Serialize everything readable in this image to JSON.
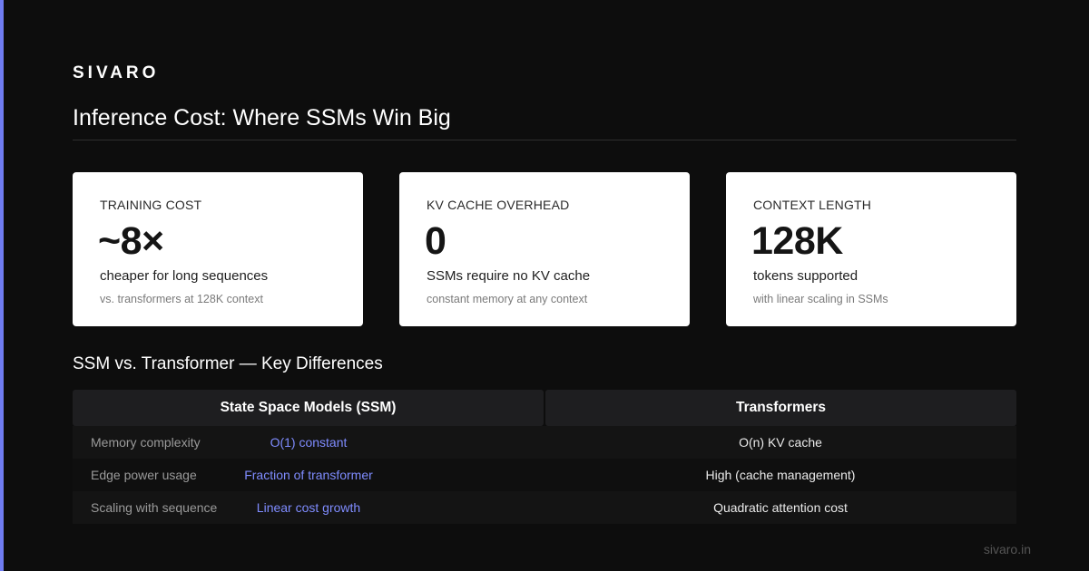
{
  "brand": "SIVARO",
  "title": "Inference Cost: Where SSMs Win Big",
  "cards": [
    {
      "label": "TRAINING COST",
      "value": "~8×",
      "desc": "cheaper for long sequences",
      "note": "vs. transformers at 128K context"
    },
    {
      "label": "KV CACHE OVERHEAD",
      "value": "0",
      "desc": "SSMs require no KV cache",
      "note": "constant memory at any context"
    },
    {
      "label": "CONTEXT LENGTH",
      "value": "128K",
      "desc": "tokens supported",
      "note": "with linear scaling in SSMs"
    }
  ],
  "comparison": {
    "title": "SSM vs. Transformer — Key Differences",
    "headers": {
      "ssm": "State Space Models (SSM)",
      "transformer": "Transformers"
    },
    "rows": [
      {
        "label": "Memory complexity",
        "ssm": "O(1) constant",
        "transformer": "O(n) KV cache"
      },
      {
        "label": "Edge power usage",
        "ssm": "Fraction of transformer",
        "transformer": "High (cache management)"
      },
      {
        "label": "Scaling with sequence",
        "ssm": "Linear cost growth",
        "transformer": "Quadratic attention cost"
      }
    ]
  },
  "footer": "sivaro.in",
  "colors": {
    "accent": "#6f7cf0",
    "ssm_text": "#7f8cff",
    "background": "#0d0d0d",
    "card": "#ffffff"
  }
}
